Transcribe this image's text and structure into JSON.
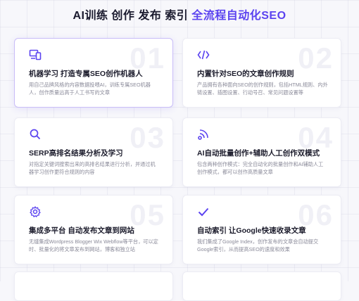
{
  "header": {
    "title_part1": "AI训练 创作 发布 索引 ",
    "title_part2": "全流程自动化SEO"
  },
  "colors": {
    "accent": "#5b43f0"
  },
  "cards": [
    {
      "num": "01",
      "icon": "devices-icon",
      "title": "机器学习 打造专属SEO创作机器人",
      "desc": "用自己品牌风格的内容数据投喂AI，训练专属SEO机器人，创作质量远高于人工书写的文章"
    },
    {
      "num": "02",
      "icon": "code-icon",
      "title": "内置针对SEO的文章创作规则",
      "desc": "产品拥有各种面向SEO的创作规则，包括HTML规则、内外链设置、插图设置、行动号召、常见问题设置等"
    },
    {
      "num": "03",
      "icon": "search-icon",
      "title": "SERP高排名结果分析及学习",
      "desc": "对指定关键词搜索出来的高排名结果进行分析，并通过机器学习创作更符合规则的内容"
    },
    {
      "num": "04",
      "icon": "broadcast-icon",
      "title": "AI自动批量创作+辅助人工创作双模式",
      "desc": "包含两种创作模式：完全自动化的批量创作和AI辅助人工创作模式，都可以创作高质量文章"
    },
    {
      "num": "05",
      "icon": "gear-icon",
      "title": "集成多平台 自动发布文章到网站",
      "desc": "无缝集成Wordpress Blogger Wix Webflow等平台，可以定时、批量化的将文章发布到网站，博客和独立站"
    },
    {
      "num": "06",
      "icon": "check-icon",
      "title": "自动索引 让Google快速收录文章",
      "desc": "我们集成了Google Index，创作发布的文章会自动提交Google索引，从而提高SEO的速度和效果"
    }
  ]
}
